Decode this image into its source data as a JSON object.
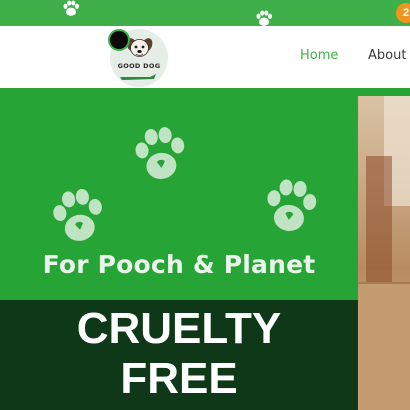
{
  "promo_bar": {
    "background_color": "#3fb049",
    "paw_icons": [
      "paw-icon",
      "paw-icon"
    ],
    "badge_label": "2",
    "badge_color": "#f0961e"
  },
  "header": {
    "logo_text": "GOOD DOG",
    "nav": [
      {
        "label": "Home",
        "active": true
      },
      {
        "label": "About",
        "active": false
      }
    ],
    "active_color": "#3fb049"
  },
  "hero": {
    "background_color": "#27a436",
    "tagline": "For Pooch & Planet",
    "banner_line_1": "CRUELTY",
    "banner_line_2": "FREE",
    "banner_color": "#0e3818",
    "paw_icons": [
      "paw-icon",
      "paw-icon",
      "paw-icon",
      "paw-icon"
    ]
  }
}
